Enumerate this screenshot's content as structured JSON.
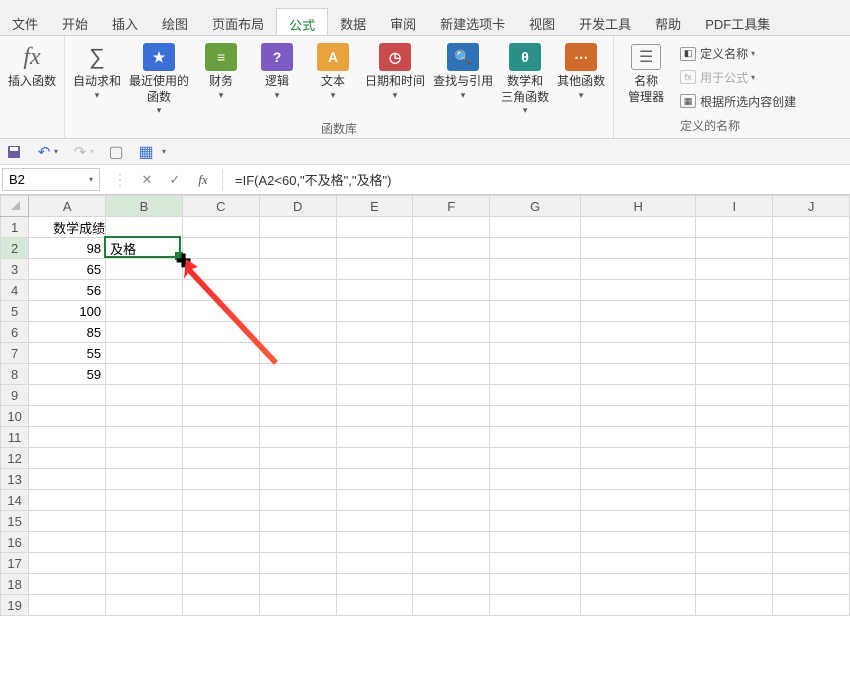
{
  "tabs": {
    "file": "文件",
    "home": "开始",
    "insert": "插入",
    "draw": "绘图",
    "layout": "页面布局",
    "formula": "公式",
    "data": "数据",
    "review": "审阅",
    "newtab": "新建选项卡",
    "view": "视图",
    "dev": "开发工具",
    "help": "帮助",
    "pdf": "PDF工具集"
  },
  "ribbon": {
    "insert_fn": "插入函数",
    "autosum": "自动求和",
    "recent": "最近使用的\n函数",
    "financial": "财务",
    "logic": "逻辑",
    "text": "文本",
    "datetime": "日期和时间",
    "lookup": "查找与引用",
    "math": "数学和\n三角函数",
    "other": "其他函数",
    "lib_label": "函数库",
    "name_mgr": "名称\n管理器",
    "def_name": "定义名称",
    "use_formula": "用于公式",
    "create_sel": "根据所选内容创建",
    "def_names_label": "定义的名称"
  },
  "namebox": "B2",
  "formula": "=IF(A2<60,\"不及格\",\"及格\")",
  "columns": [
    "A",
    "B",
    "C",
    "D",
    "E",
    "F",
    "G",
    "H",
    "I",
    "J"
  ],
  "cells": {
    "A1": "数学成绩",
    "A2": "98",
    "B2": "及格",
    "A3": "65",
    "A4": "56",
    "A5": "100",
    "A6": "85",
    "A7": "55",
    "A8": "59"
  },
  "chart_data": {
    "type": "table",
    "title": "数学成绩",
    "categories": [
      "A2",
      "A3",
      "A4",
      "A5",
      "A6",
      "A7",
      "A8"
    ],
    "values": [
      98,
      65,
      56,
      100,
      85,
      55,
      59
    ]
  }
}
